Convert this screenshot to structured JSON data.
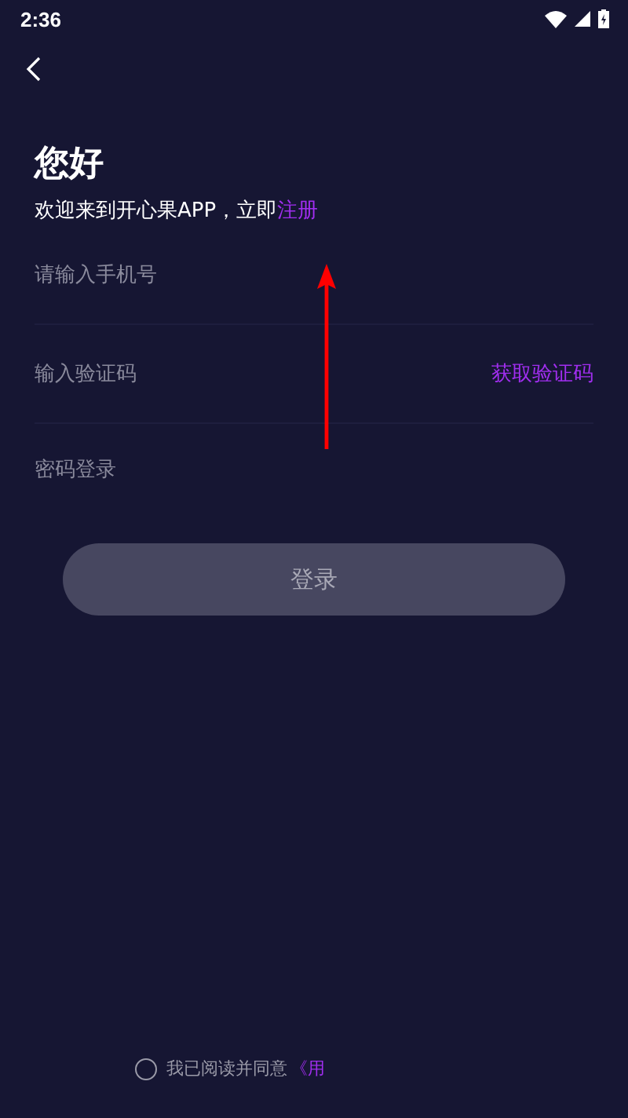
{
  "status_bar": {
    "time": "2:36"
  },
  "greeting": {
    "title": "您好",
    "subtitle": "欢迎来到开心果APP，立即",
    "register_link": "注册"
  },
  "fields": [
    {
      "kind": "phone",
      "placeholder": "请输入手机号"
    },
    {
      "kind": "code",
      "placeholder": "输入验证码",
      "action": "获取验证码"
    }
  ],
  "password_login_link": "密码登录",
  "login_button": {
    "label": "登录",
    "disabled": true
  },
  "agreement": {
    "checked": false,
    "text": "我已阅读并同意",
    "link": "《用"
  }
}
